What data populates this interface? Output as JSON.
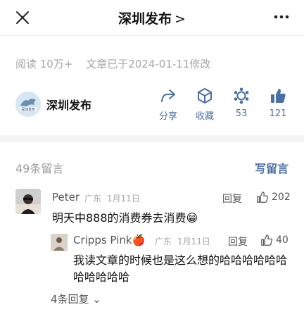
{
  "nav": {
    "title": "深圳发布",
    "title_chevron": ">"
  },
  "meta": {
    "reads": "阅读 10万+",
    "edited": "文章已于2024-01-11修改"
  },
  "author": {
    "name": "深圳发布",
    "logo_text": "深圳发布"
  },
  "actions": {
    "share": "分享",
    "collect": "收藏",
    "wow": "53",
    "like": "121"
  },
  "comments": {
    "count": "49条留言",
    "write": "写留言",
    "items": [
      {
        "name": "Peter",
        "region": "广东",
        "date": "1月11日",
        "reply_label": "回复",
        "likes": "202",
        "text": "明天中888的消费券去消费😁"
      }
    ],
    "reply": {
      "name": "Cripps Pink🍎",
      "region": "广东",
      "date": "1月11日",
      "reply_label": "回复",
      "likes": "40",
      "text": "我读文章的时候也是这么想的哈哈哈哈哈哈哈哈哈哈哈"
    },
    "more_replies": "4条回复 ⌄"
  },
  "colors": {
    "link_blue": "#4a6fa5",
    "meta_gray": "#a6a6a6"
  },
  "icons": [
    "close-icon",
    "more-icon",
    "share-icon",
    "collect-icon",
    "wow-icon",
    "like-icon",
    "thumbs-up-icon"
  ]
}
